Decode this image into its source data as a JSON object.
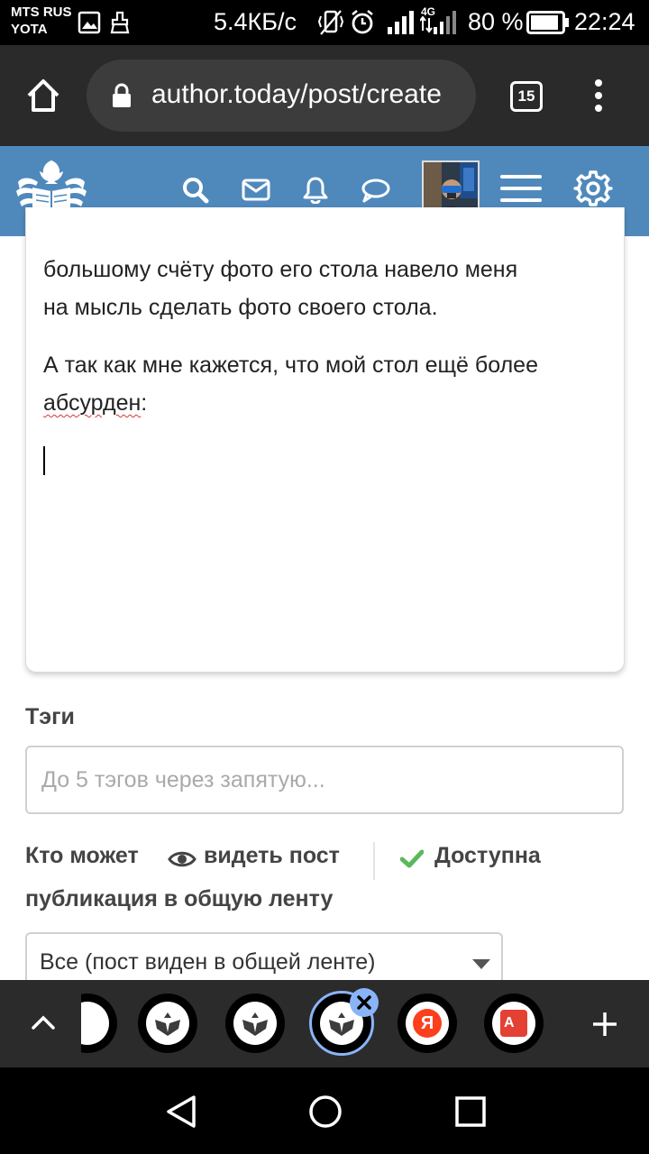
{
  "status_bar": {
    "carrier_line1": "MTS RUS",
    "carrier_line2": "YOTA",
    "network_speed": "5.4КБ/с",
    "network_type": "4G",
    "battery": "80 %",
    "time": "22:24"
  },
  "browser": {
    "url": "author.today/post/create",
    "tab_count": "15"
  },
  "site_header": {
    "brand_color": "#4f89bc",
    "icons": [
      "logo-icon",
      "search-icon",
      "mail-icon",
      "bell-icon",
      "chat-icon",
      "avatar",
      "menu-icon",
      "gear-icon"
    ]
  },
  "editor": {
    "line1": "большому счёту фото его стола навело меня",
    "line2": "на мысль сделать фото своего стола.",
    "line3": "А так как мне кажется, что мой стол ещё более",
    "line4_word": "абсурден",
    "line4_rest": ":"
  },
  "tags": {
    "label": "Тэги",
    "placeholder": "До 5 тэгов через запятую..."
  },
  "visibility": {
    "prefix": "Кто может",
    "label": "видеть пост",
    "feed_label": "Доступна",
    "feed_label_line2": "публикация в общую ленту",
    "selected": "Все (пост виден в общей ленте)"
  },
  "tab_strip": {
    "tabs": [
      "author-today",
      "author-today",
      "author-today",
      "author-today",
      "yandex",
      "translate"
    ],
    "active_index": 3,
    "yandex_label": "Я",
    "translate_label": "A"
  },
  "colors": {
    "check": "#5cb85c",
    "active_tab_ring": "#8ab4f8",
    "yandex_red": "#fc3f1d",
    "translate_red": "#e34133"
  }
}
